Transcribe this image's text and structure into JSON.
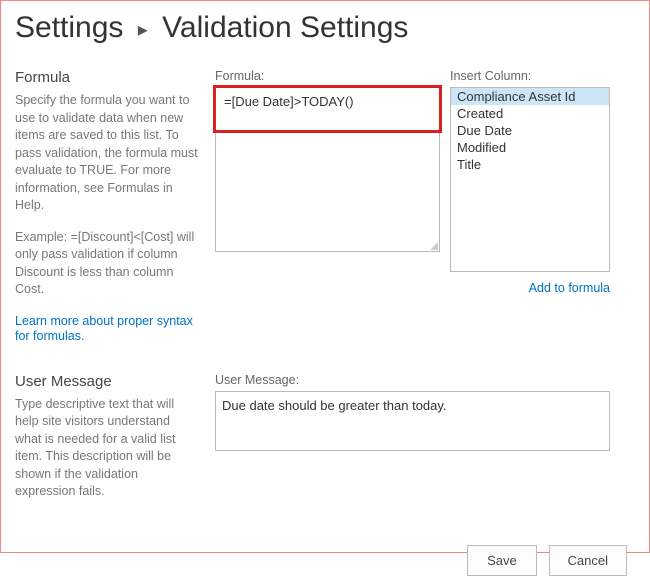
{
  "breadcrumb": {
    "parent": "Settings",
    "current": "Validation Settings"
  },
  "formula_section": {
    "title": "Formula",
    "desc": "Specify the formula you want to use to validate data when new items are saved to this list. To pass validation, the formula must evaluate to TRUE. For more information, see Formulas in Help.",
    "example": "Example: =[Discount]<[Cost] will only pass validation if column Discount is less than column Cost.",
    "learn_link": "Learn more about proper syntax for formulas.",
    "field_label": "Formula:",
    "value": "=[Due Date]>TODAY()"
  },
  "columns": {
    "label": "Insert Column:",
    "items": [
      "Compliance Asset Id",
      "Created",
      "Due Date",
      "Modified",
      "Title"
    ],
    "selected": "Compliance Asset Id",
    "add_link": "Add to formula"
  },
  "message_section": {
    "title": "User Message",
    "desc": "Type descriptive text that will help site visitors understand what is needed for a valid list item. This description will be shown if the validation expression fails.",
    "field_label": "User Message:",
    "value": "Due date should be greater than today."
  },
  "buttons": {
    "save": "Save",
    "cancel": "Cancel"
  }
}
